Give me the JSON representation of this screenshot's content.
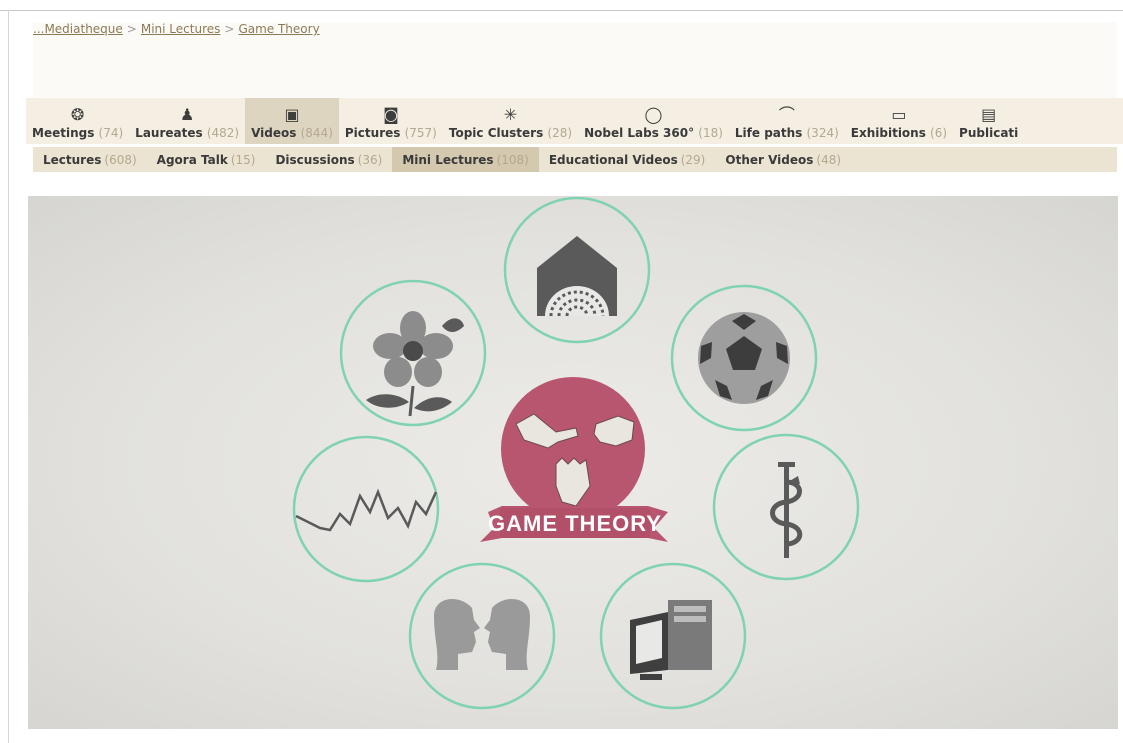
{
  "breadcrumb": {
    "items": [
      "...Mediatheque",
      "Mini Lectures",
      "Game Theory"
    ],
    "separator": ">"
  },
  "main_nav": [
    {
      "label": "Meetings",
      "count": "(74)",
      "icon": "meetings-icon",
      "glyph": "❂",
      "active": false
    },
    {
      "label": "Laureates",
      "count": "(482)",
      "icon": "person-icon",
      "glyph": "♟",
      "active": false
    },
    {
      "label": "Videos",
      "count": "(844)",
      "icon": "tv-icon",
      "glyph": "▣",
      "active": true
    },
    {
      "label": "Pictures",
      "count": "(757)",
      "icon": "camera-icon",
      "glyph": "◙",
      "active": false
    },
    {
      "label": "Topic Clusters",
      "count": "(28)",
      "icon": "cluster-icon",
      "glyph": "✳",
      "active": false
    },
    {
      "label": "Nobel Labs 360°",
      "count": "(18)",
      "icon": "panorama-icon",
      "glyph": "◯",
      "active": false
    },
    {
      "label": "Life paths",
      "count": "(324)",
      "icon": "path-icon",
      "glyph": "⌒",
      "active": false
    },
    {
      "label": "Exhibitions",
      "count": "(6)",
      "icon": "exhibition-icon",
      "glyph": "▭",
      "active": false
    },
    {
      "label": "Publicati",
      "count": "",
      "icon": "book-icon",
      "glyph": "▤",
      "active": false
    }
  ],
  "sub_nav": [
    {
      "label": "Lectures",
      "count": "(608)",
      "active": false
    },
    {
      "label": "Agora Talk",
      "count": "(15)",
      "active": false
    },
    {
      "label": "Discussions",
      "count": "(36)",
      "active": false
    },
    {
      "label": "Mini Lectures",
      "count": "(108)",
      "active": true
    },
    {
      "label": "Educational Videos",
      "count": "(29)",
      "active": false
    },
    {
      "label": "Other Videos",
      "count": "(48)",
      "active": false
    }
  ],
  "video": {
    "banner_text": "GAME THEORY",
    "colors": {
      "ring": "#7fd2b3",
      "center": "#b85670",
      "banner": "#b85670",
      "icon": "#5a5a5a",
      "icon_light": "#8c8c8c"
    }
  }
}
